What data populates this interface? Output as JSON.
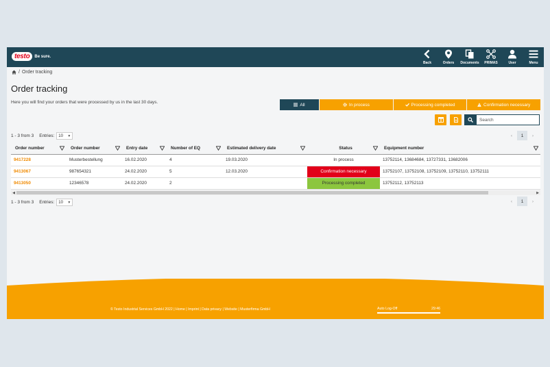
{
  "header": {
    "logo_text": "testo",
    "slogan": "Be sure.",
    "nav": [
      {
        "label": "Back",
        "icon": "back-icon"
      },
      {
        "label": "Orders",
        "icon": "map-pin-icon"
      },
      {
        "label": "Documents",
        "icon": "documents-icon"
      },
      {
        "label": "PRIMAS",
        "icon": "network-icon"
      },
      {
        "label": "User",
        "icon": "user-icon"
      },
      {
        "label": "Menu",
        "icon": "hamburger-icon"
      }
    ]
  },
  "breadcrumb": {
    "sep": "/",
    "current": "Order tracking"
  },
  "page": {
    "title": "Order tracking",
    "intro": "Here you will find your orders that were processed by us in the last 30 days."
  },
  "filters": [
    {
      "label": "All",
      "icon": "list-icon",
      "active": true
    },
    {
      "label": "In process",
      "icon": "gear-icon"
    },
    {
      "label": "Processing completed",
      "icon": "check-icon"
    },
    {
      "label": "Confirmation necessary",
      "icon": "warning-icon"
    }
  ],
  "search": {
    "placeholder": "Search"
  },
  "pagination": {
    "info": "1 - 3 from 3",
    "entries_label": "Entries:",
    "entries_value": "10",
    "page": "1",
    "prev": "‹",
    "next": "›"
  },
  "table": {
    "columns": [
      "Order number",
      "Order number",
      "Entry date",
      "Number of EQ",
      "Estimated delivery date",
      "Status",
      "Equipment number"
    ],
    "rows": [
      {
        "order": "9417228",
        "ref": "Musterbestellung",
        "entry": "16.02.2020",
        "eq": "4",
        "delivery": "19.03.2020",
        "status": "In process",
        "status_type": "process",
        "equipment": "13752114, 13684684, 13727331, 13682006"
      },
      {
        "order": "9413067",
        "ref": "987654321",
        "entry": "24.02.2020",
        "eq": "5",
        "delivery": "12.03.2020",
        "status": "Confirmation necessary",
        "status_type": "confirm",
        "equipment": "13752107, 13752108, 13752109, 13752110, 13752111"
      },
      {
        "order": "9413050",
        "ref": "12346578",
        "entry": "24.02.2020",
        "eq": "2",
        "delivery": "",
        "status": "Processing completed",
        "status_type": "done",
        "equipment": "13752112, 13752113"
      }
    ]
  },
  "footer": {
    "text": "© Testo Industrial Services GmbH 2022 | Home | Imprint | Data privacy | Website | Musterfirma GmbH",
    "auto_logoff_label": "Auto Log-Off",
    "auto_logoff_time": "29:46"
  },
  "colors": {
    "brand_dark": "#1f4757",
    "accent": "#f7a100",
    "danger": "#e2001a",
    "success": "#8cc63e"
  }
}
